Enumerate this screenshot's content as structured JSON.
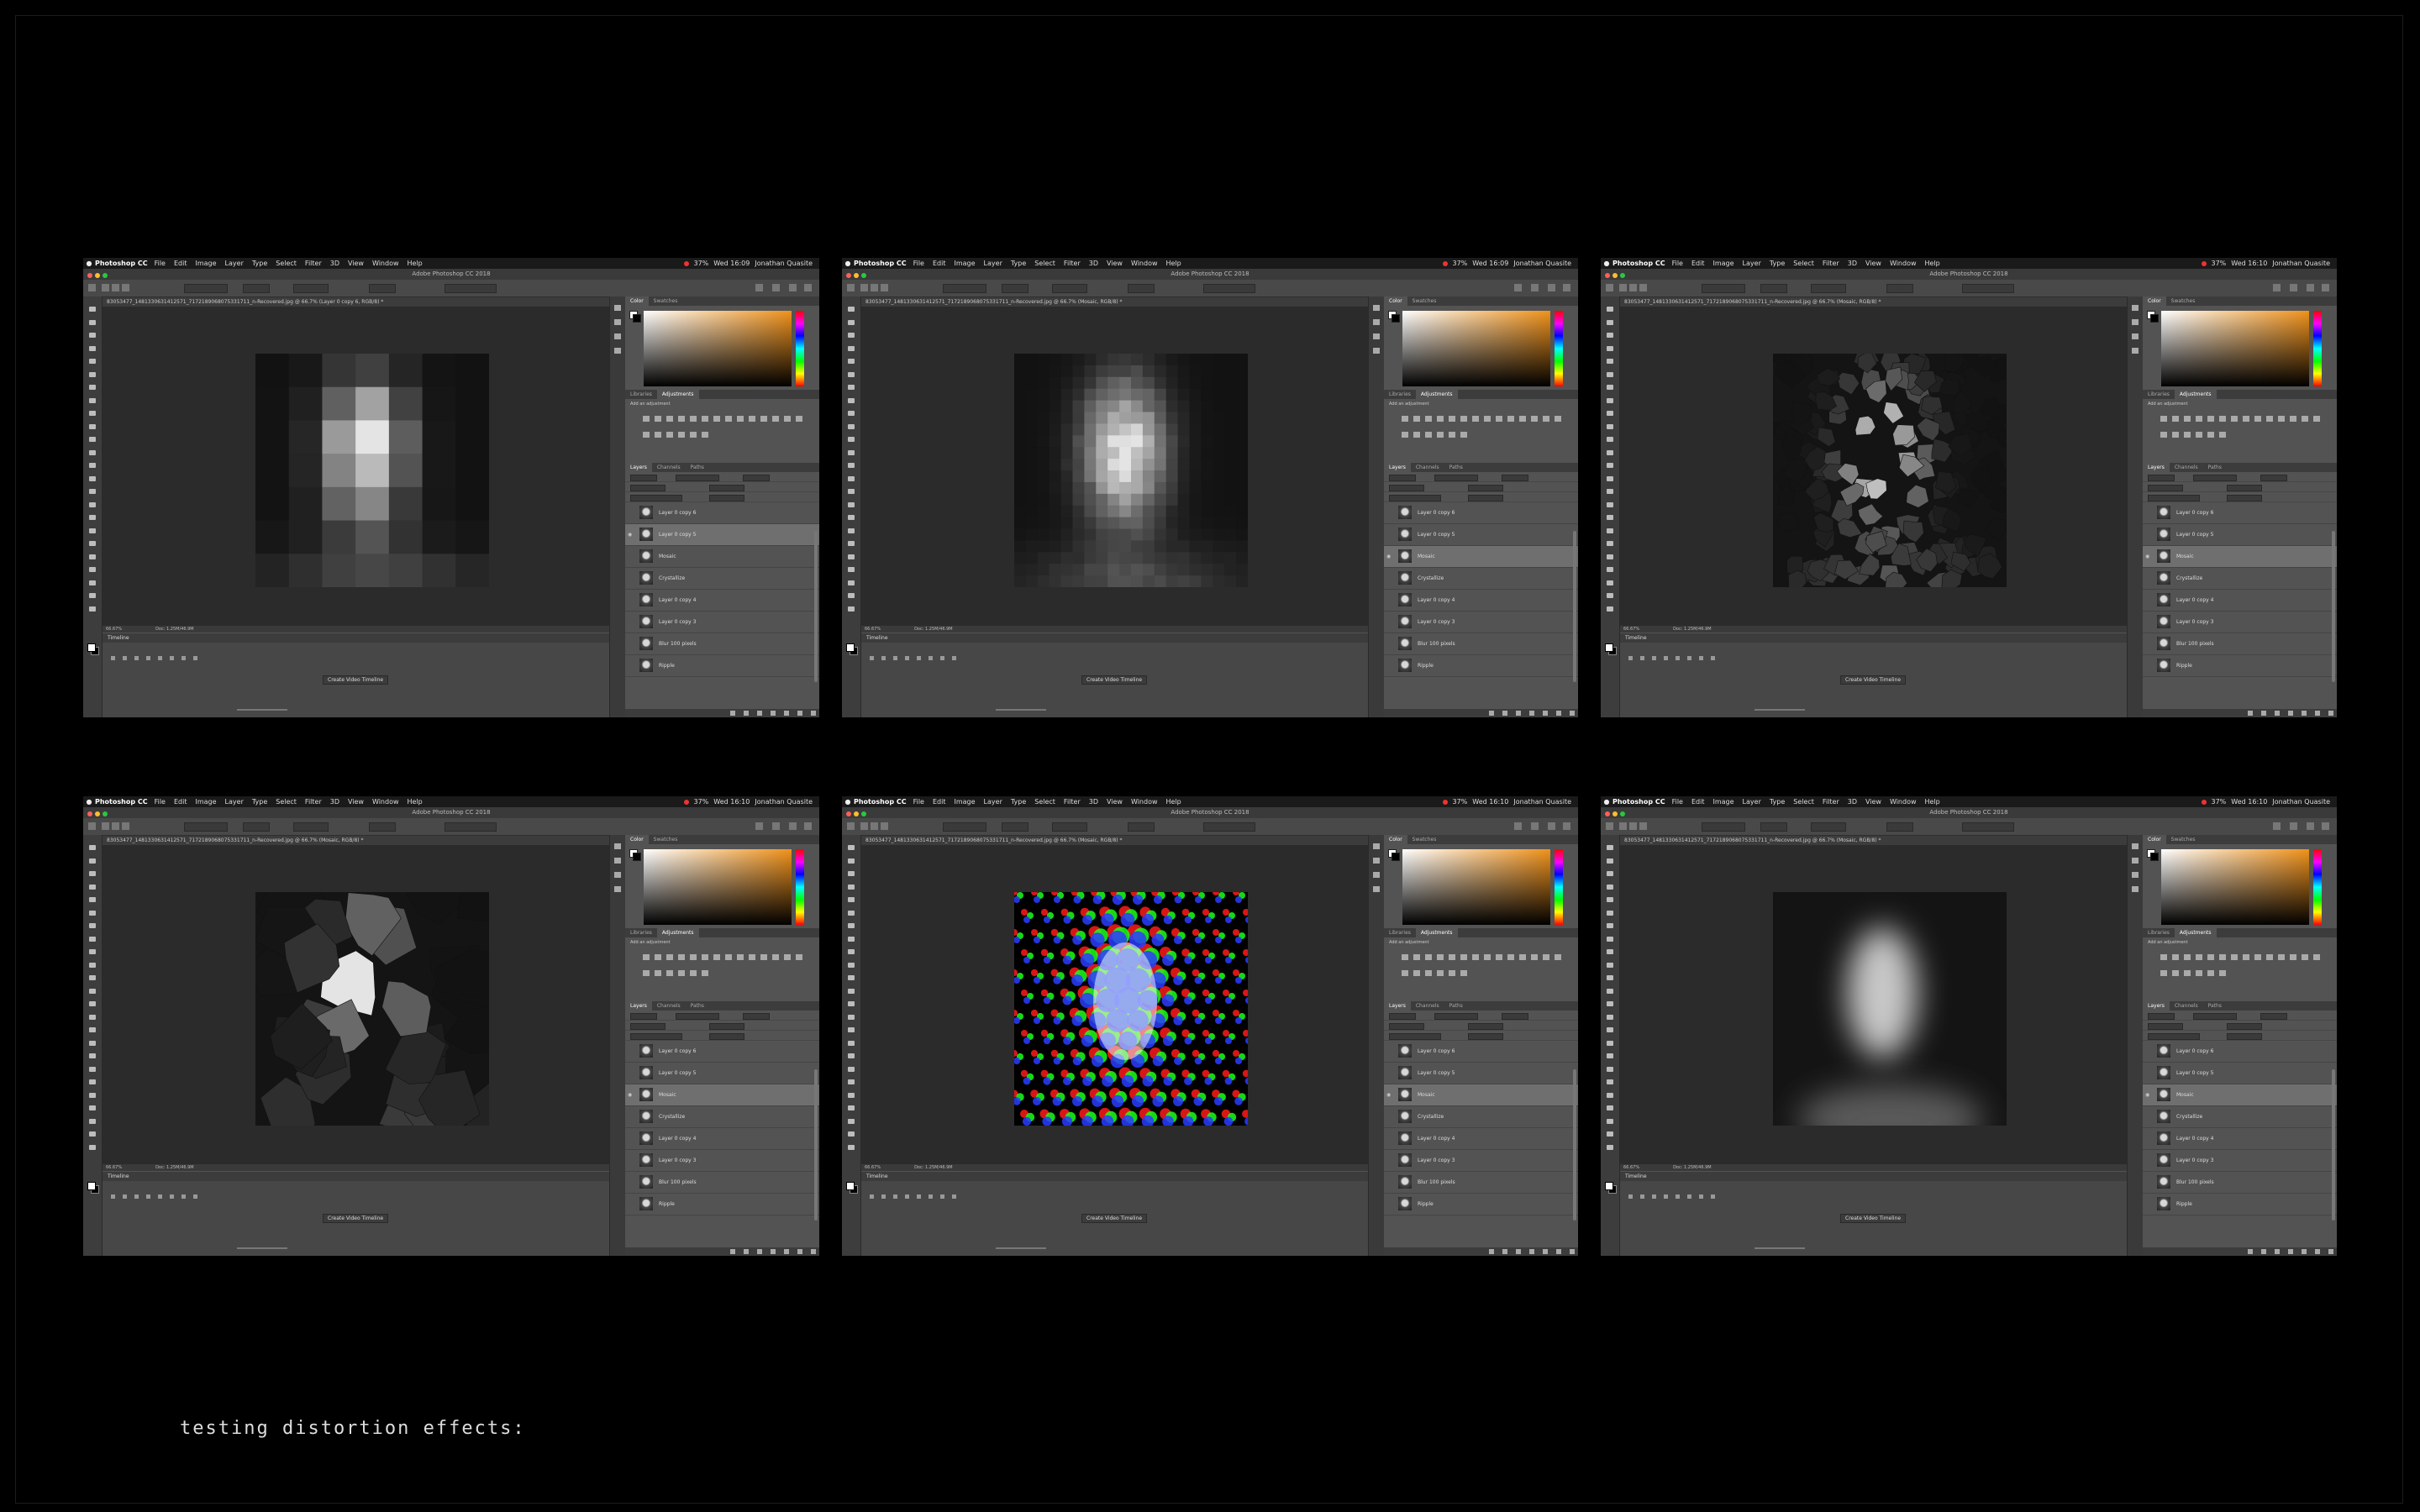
{
  "caption": "testing distortion effects:",
  "menubar": {
    "app_name": "Photoshop CC",
    "menus": [
      "File",
      "Edit",
      "Image",
      "Layer",
      "Type",
      "Select",
      "Filter",
      "3D",
      "View",
      "Window",
      "Help"
    ],
    "battery": "37%",
    "user": "Jonathan Quasite"
  },
  "panels": {
    "color_tabs": [
      "Color",
      "Swatches"
    ],
    "adjust_tabs": [
      "Libraries",
      "Adjustments"
    ],
    "adjust_label": "Add an adjustment",
    "layers_tabs": [
      "Layers",
      "Channels",
      "Paths"
    ],
    "layers": [
      "Layer 0 copy 6",
      "Layer 0 copy 5",
      "Mosaic",
      "Crystallize",
      "Layer 0 copy 4",
      "Layer 0 copy 3",
      "Blur 100 pixels",
      "Ripple"
    ],
    "timeline_title": "Timeline",
    "timeline_button": "Create Video Timeline"
  },
  "screens": [
    {
      "effect": "mosaic-large",
      "title": "Adobe Photoshop CC 2018",
      "doc_tab": "83053477_1481330631412571_7172189068075331711_n-Recovered.jpg @ 66.7% (Layer 0 copy 6, RGB/8) *",
      "time": "Wed 16:09",
      "zoom": "66.67%",
      "doc_size": "Doc: 1.25M/46.9M",
      "selected_layer": 1
    },
    {
      "effect": "mosaic-small",
      "title": "Adobe Photoshop CC 2018",
      "doc_tab": "83053477_1481330631412571_7172189068075331711_n-Recovered.jpg @ 66.7% (Mosaic, RGB/8) *",
      "time": "Wed 16:09",
      "zoom": "66.67%",
      "doc_size": "Doc: 1.25M/46.9M",
      "selected_layer": 2
    },
    {
      "effect": "crystallize-small",
      "title": "Adobe Photoshop CC 2018",
      "doc_tab": "83053477_1481330631412571_7172189068075331711_n-Recovered.jpg @ 66.7% (Mosaic, RGB/8) *",
      "time": "Wed 16:10",
      "zoom": "66.67%",
      "doc_size": "Doc: 1.25M/46.9M",
      "selected_layer": 2
    },
    {
      "effect": "crystallize-large",
      "title": "Adobe Photoshop CC 2018",
      "doc_tab": "83053477_1481330631412571_7172189068075331711_n-Recovered.jpg @ 66.7% (Mosaic, RGB/8) *",
      "time": "Wed 16:10",
      "zoom": "66.67%",
      "doc_size": "Doc: 1.25M/46.9M",
      "selected_layer": 2
    },
    {
      "effect": "halftone-color",
      "title": "Adobe Photoshop CC 2018",
      "doc_tab": "83053477_1481330631412571_7172189068075331711_n-Recovered.jpg @ 66.7% (Mosaic, RGB/8) *",
      "time": "Wed 16:10",
      "zoom": "66.67%",
      "doc_size": "Doc: 1.25M/46.9M",
      "selected_layer": 2
    },
    {
      "effect": "blur",
      "title": "Adobe Photoshop CC 2018",
      "doc_tab": "83053477_1481330631412571_7172189068075331711_n-Recovered.jpg @ 66.7% (Mosaic, RGB/8) *",
      "time": "Wed 16:10",
      "zoom": "66.67%",
      "doc_size": "Doc: 1.25M/46.9M",
      "selected_layer": 2
    }
  ]
}
